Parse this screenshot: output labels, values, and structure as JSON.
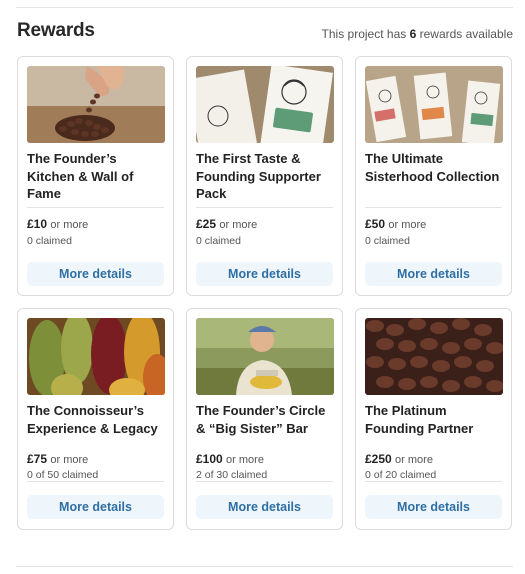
{
  "header": {
    "title": "Rewards",
    "count_prefix": "This project has ",
    "count_value": "6",
    "count_suffix": " rewards available"
  },
  "rewards": [
    {
      "name": "The Founder’s Kitchen & Wall of Fame",
      "price": "£10",
      "more": "or more",
      "claimed": "0 claimed",
      "button": "More details",
      "image": "cacao-beans-hand-image"
    },
    {
      "name": "The First Taste & Founding Supporter Pack",
      "price": "£25",
      "more": "or more",
      "claimed": "0 claimed",
      "button": "More details",
      "image": "chocolate-bar-packaging-image"
    },
    {
      "name": "The Ultimate Sisterhood Collection",
      "price": "£50",
      "more": "or more",
      "claimed": "0 claimed",
      "button": "More details",
      "image": "chocolate-bars-trio-image"
    },
    {
      "name": "The Connoisseur’s Experience & Legacy",
      "price": "£75",
      "more": "or more",
      "claimed": "0 of 50 claimed",
      "button": "More details",
      "image": "cacao-pods-image"
    },
    {
      "name": "The Founder’s Circle & “Big Sister” Bar",
      "price": "£100",
      "more": "or more",
      "claimed": "2 of 30 claimed",
      "button": "More details",
      "image": "farmer-with-pod-image"
    },
    {
      "name": "The Platinum Founding Partner",
      "price": "£250",
      "more": "or more",
      "claimed": "0 of 20 claimed",
      "button": "More details",
      "image": "roasted-beans-image"
    }
  ]
}
